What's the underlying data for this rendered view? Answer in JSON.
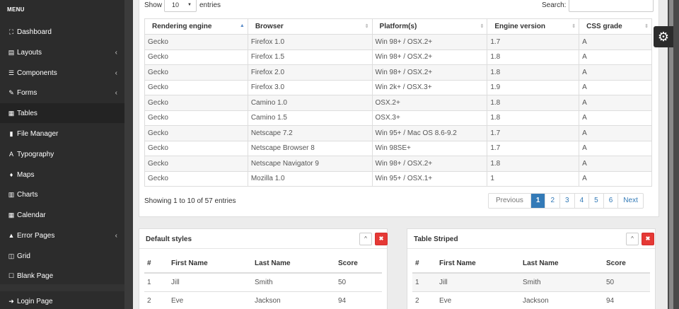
{
  "sidebar": {
    "header": "MENU",
    "items": [
      {
        "label": "Dashboard",
        "icon": "⛶"
      },
      {
        "label": "Layouts",
        "icon": "▤",
        "arrow": "‹"
      },
      {
        "label": "Components",
        "icon": "☰",
        "arrow": "‹"
      },
      {
        "label": "Forms",
        "icon": "✎",
        "arrow": "‹"
      },
      {
        "label": "Tables",
        "icon": "▦"
      },
      {
        "label": "File Manager",
        "icon": "▮"
      },
      {
        "label": "Typography",
        "icon": "A"
      },
      {
        "label": "Maps",
        "icon": "♦"
      },
      {
        "label": "Charts",
        "icon": "▥"
      },
      {
        "label": "Calendar",
        "icon": "▦"
      },
      {
        "label": "Error Pages",
        "icon": "▲",
        "arrow": "‹"
      },
      {
        "label": "Grid",
        "icon": "◫"
      },
      {
        "label": "Blank Page",
        "icon": "☐"
      },
      {
        "label": "Login Page",
        "icon": "➜"
      }
    ]
  },
  "toolbar": {
    "show_label": "Show",
    "show_value": "10",
    "entries_label": "entries",
    "search_label": "Search:"
  },
  "datatable": {
    "headers": [
      "Rendering engine",
      "Browser",
      "Platform(s)",
      "Engine version",
      "CSS grade"
    ],
    "rows": [
      [
        "Gecko",
        "Firefox 1.0",
        "Win 98+ / OSX.2+",
        "1.7",
        "A"
      ],
      [
        "Gecko",
        "Firefox 1.5",
        "Win 98+ / OSX.2+",
        "1.8",
        "A"
      ],
      [
        "Gecko",
        "Firefox 2.0",
        "Win 98+ / OSX.2+",
        "1.8",
        "A"
      ],
      [
        "Gecko",
        "Firefox 3.0",
        "Win 2k+ / OSX.3+",
        "1.9",
        "A"
      ],
      [
        "Gecko",
        "Camino 1.0",
        "OSX.2+",
        "1.8",
        "A"
      ],
      [
        "Gecko",
        "Camino 1.5",
        "OSX.3+",
        "1.8",
        "A"
      ],
      [
        "Gecko",
        "Netscape 7.2",
        "Win 95+ / Mac OS 8.6-9.2",
        "1.7",
        "A"
      ],
      [
        "Gecko",
        "Netscape Browser 8",
        "Win 98SE+",
        "1.7",
        "A"
      ],
      [
        "Gecko",
        "Netscape Navigator 9",
        "Win 98+ / OSX.2+",
        "1.8",
        "A"
      ],
      [
        "Gecko",
        "Mozilla 1.0",
        "Win 95+ / OSX.1+",
        "1",
        "A"
      ]
    ],
    "info": "Showing 1 to 10 of 57 entries",
    "pagination": {
      "previous": "Previous",
      "pages": [
        "1",
        "2",
        "3",
        "4",
        "5",
        "6"
      ],
      "next": "Next"
    }
  },
  "panels": [
    {
      "title": "Default styles",
      "minimize": "^",
      "close": "✖",
      "headers": [
        "#",
        "First Name",
        "Last Name",
        "Score"
      ],
      "rows": [
        [
          "1",
          "Jill",
          "Smith",
          "50"
        ],
        [
          "2",
          "Eve",
          "Jackson",
          "94"
        ]
      ]
    },
    {
      "title": "Table Striped",
      "minimize": "^",
      "close": "✖",
      "headers": [
        "#",
        "First Name",
        "Last Name",
        "Score"
      ],
      "rows": [
        [
          "1",
          "Jill",
          "Smith",
          "50"
        ],
        [
          "2",
          "Eve",
          "Jackson",
          "94"
        ]
      ]
    }
  ],
  "gear": {
    "icon": "⚙"
  },
  "colors": {
    "sidebar": "#2c2c2c",
    "accent": "#337ab7",
    "close": "#e53935"
  }
}
